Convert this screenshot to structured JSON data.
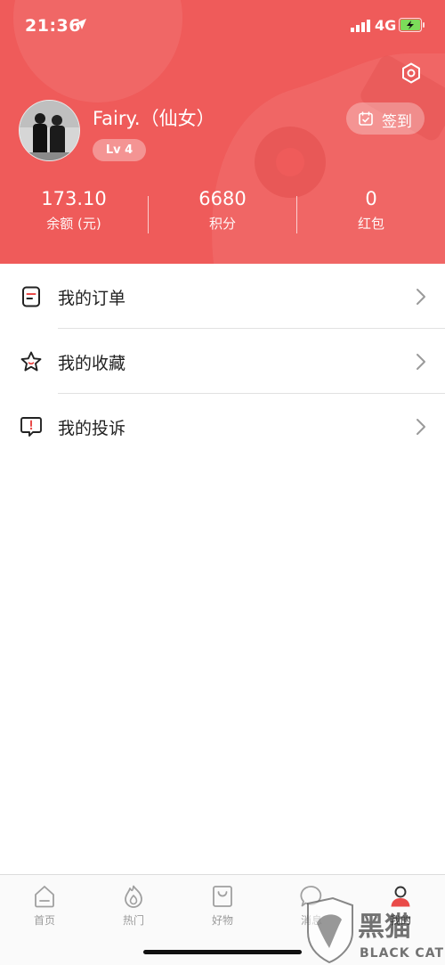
{
  "status_bar": {
    "time": "21:36",
    "network": "4G"
  },
  "profile": {
    "username": "Fairy.（仙女）",
    "level": "Lv 4"
  },
  "checkin": {
    "label": "签到"
  },
  "stats": [
    {
      "value": "173.10",
      "label": "余额 (元)"
    },
    {
      "value": "6680",
      "label": "积分"
    },
    {
      "value": "0",
      "label": "红包"
    }
  ],
  "menu": {
    "items": [
      {
        "label": "我的订单",
        "icon": "order-icon"
      },
      {
        "label": "我的收藏",
        "icon": "star-icon"
      },
      {
        "label": "我的投诉",
        "icon": "complaint-icon"
      }
    ]
  },
  "tabbar": {
    "tabs": [
      {
        "label": "首页",
        "icon": "home-icon"
      },
      {
        "label": "热门",
        "icon": "flame-icon"
      },
      {
        "label": "好物",
        "icon": "shopping-bag-icon"
      },
      {
        "label": "消息",
        "icon": "message-icon"
      },
      {
        "label": "我的",
        "icon": "user-icon",
        "active": true
      }
    ]
  },
  "watermark": {
    "text_cn": "黑猫",
    "text_en": "BLACK CAT"
  },
  "colors": {
    "primary": "#ef5b5a",
    "tab_active": "#e94a48",
    "tab_inactive": "#9b9b9b"
  }
}
